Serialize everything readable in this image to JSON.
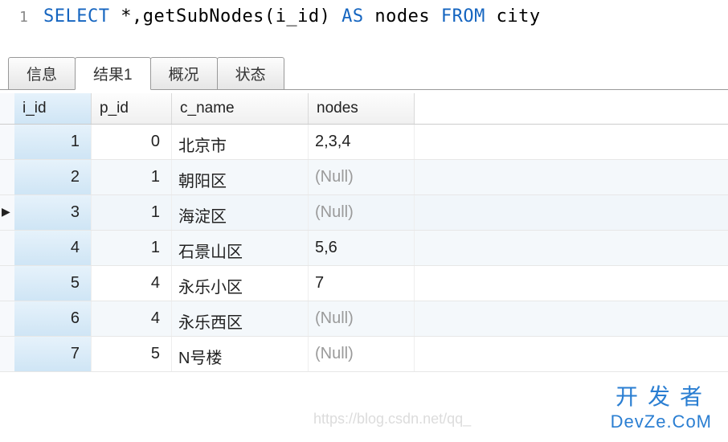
{
  "editor": {
    "line_number": "1",
    "sql": {
      "kw_select": "SELECT",
      "star_comma": " *,",
      "func": "getSubNodes",
      "open": "(",
      "arg": "i_id",
      "close": ")",
      "kw_as": "AS",
      "alias": "nodes",
      "kw_from": "FROM",
      "table": "city"
    }
  },
  "tabs": {
    "info": "信息",
    "result1": "结果1",
    "profile": "概况",
    "status": "状态"
  },
  "columns": {
    "i_id": "i_id",
    "p_id": "p_id",
    "c_name": "c_name",
    "nodes": "nodes"
  },
  "null_label": "(Null)",
  "rows": [
    {
      "i_id": "1",
      "p_id": "0",
      "c_name": "北京市",
      "nodes": "2,3,4",
      "selected": false
    },
    {
      "i_id": "2",
      "p_id": "1",
      "c_name": "朝阳区",
      "nodes": null,
      "selected": false
    },
    {
      "i_id": "3",
      "p_id": "1",
      "c_name": "海淀区",
      "nodes": null,
      "selected": true
    },
    {
      "i_id": "4",
      "p_id": "1",
      "c_name": "石景山区",
      "nodes": "5,6",
      "selected": false
    },
    {
      "i_id": "5",
      "p_id": "4",
      "c_name": "永乐小区",
      "nodes": "7",
      "selected": false
    },
    {
      "i_id": "6",
      "p_id": "4",
      "c_name": "永乐西区",
      "nodes": null,
      "selected": false
    },
    {
      "i_id": "7",
      "p_id": "5",
      "c_name": "N号楼",
      "nodes": null,
      "selected": false
    }
  ],
  "watermark": {
    "line1": "开发者",
    "line2": "DevZe.CoM",
    "faint": "https://blog.csdn.net/qq_"
  }
}
